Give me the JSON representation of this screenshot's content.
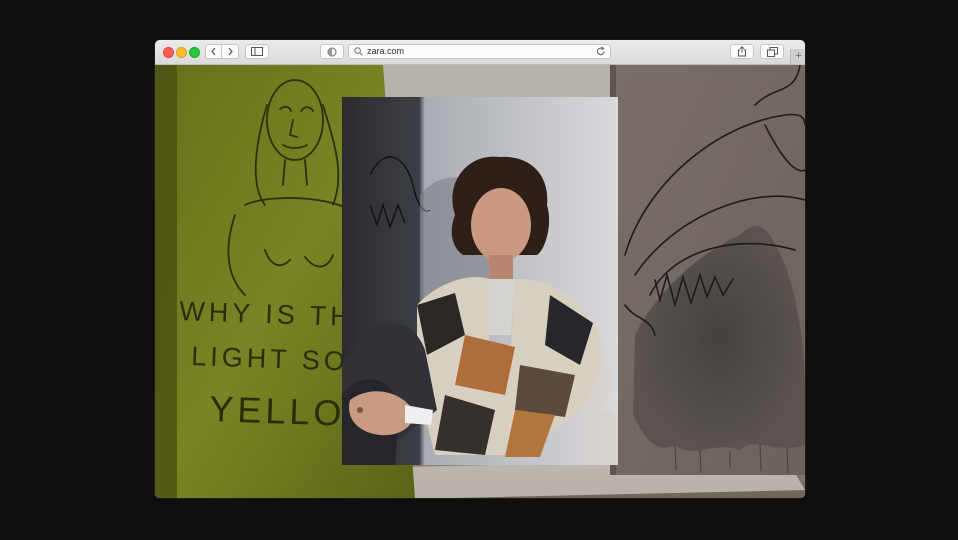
{
  "browser": {
    "url": "zara.com",
    "traffic_lights": {
      "close": "#fe5f57",
      "minimize": "#febc2e",
      "zoom": "#28c840"
    }
  },
  "content": {
    "painting_text_lines": [
      "WHY IS TH",
      "LIGHT SO",
      "YELLO"
    ],
    "painting_colors": {
      "yellow": "#6f7a1d",
      "grey": "#7c7068"
    }
  }
}
